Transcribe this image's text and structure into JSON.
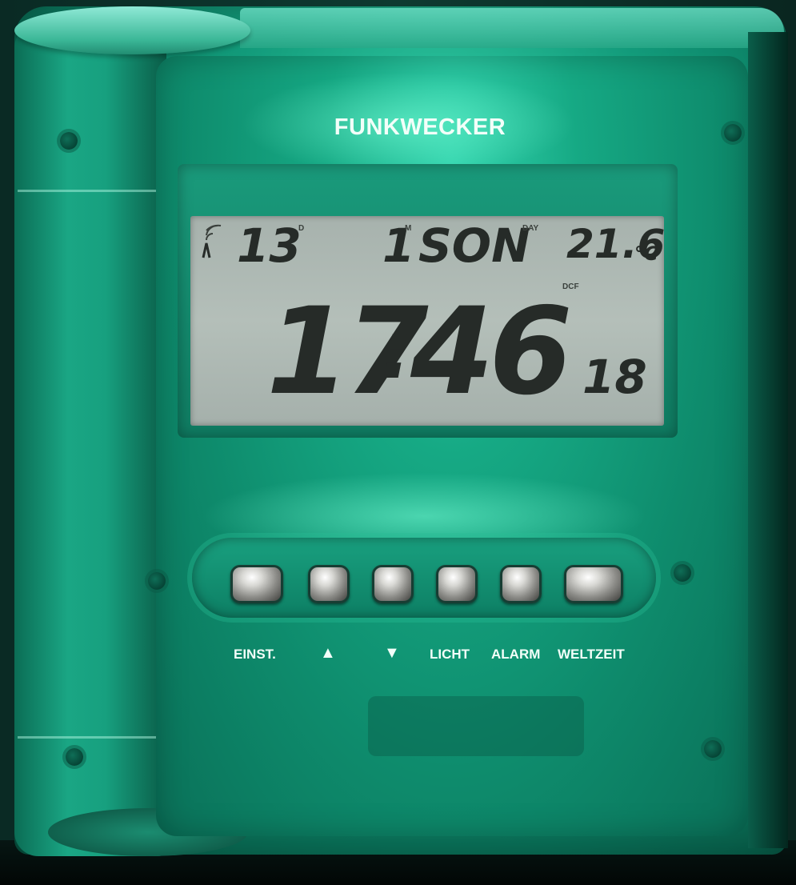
{
  "device": {
    "brand": "FUNKWECKER",
    "display": {
      "date_day": "13",
      "date_day_marker": "D",
      "month": "1",
      "month_marker": "M",
      "weekday": "SON",
      "weekday_marker": "DAY",
      "temperature": "21.6",
      "temperature_unit": "°C",
      "dcf_label": "DCF",
      "time_hours": "17",
      "time_minutes": "46",
      "time_seconds": "18"
    },
    "buttons": [
      {
        "label": "EINST."
      },
      {
        "label": "▲"
      },
      {
        "label": "▼"
      },
      {
        "label": "LICHT"
      },
      {
        "label": "ALARM"
      },
      {
        "label": "WELTZEIT"
      }
    ],
    "colors": {
      "housing": "#139c7b",
      "lcd_background": "#b0bbb6",
      "lcd_segment": "#262b28",
      "label_text": "#f2fff9"
    }
  }
}
